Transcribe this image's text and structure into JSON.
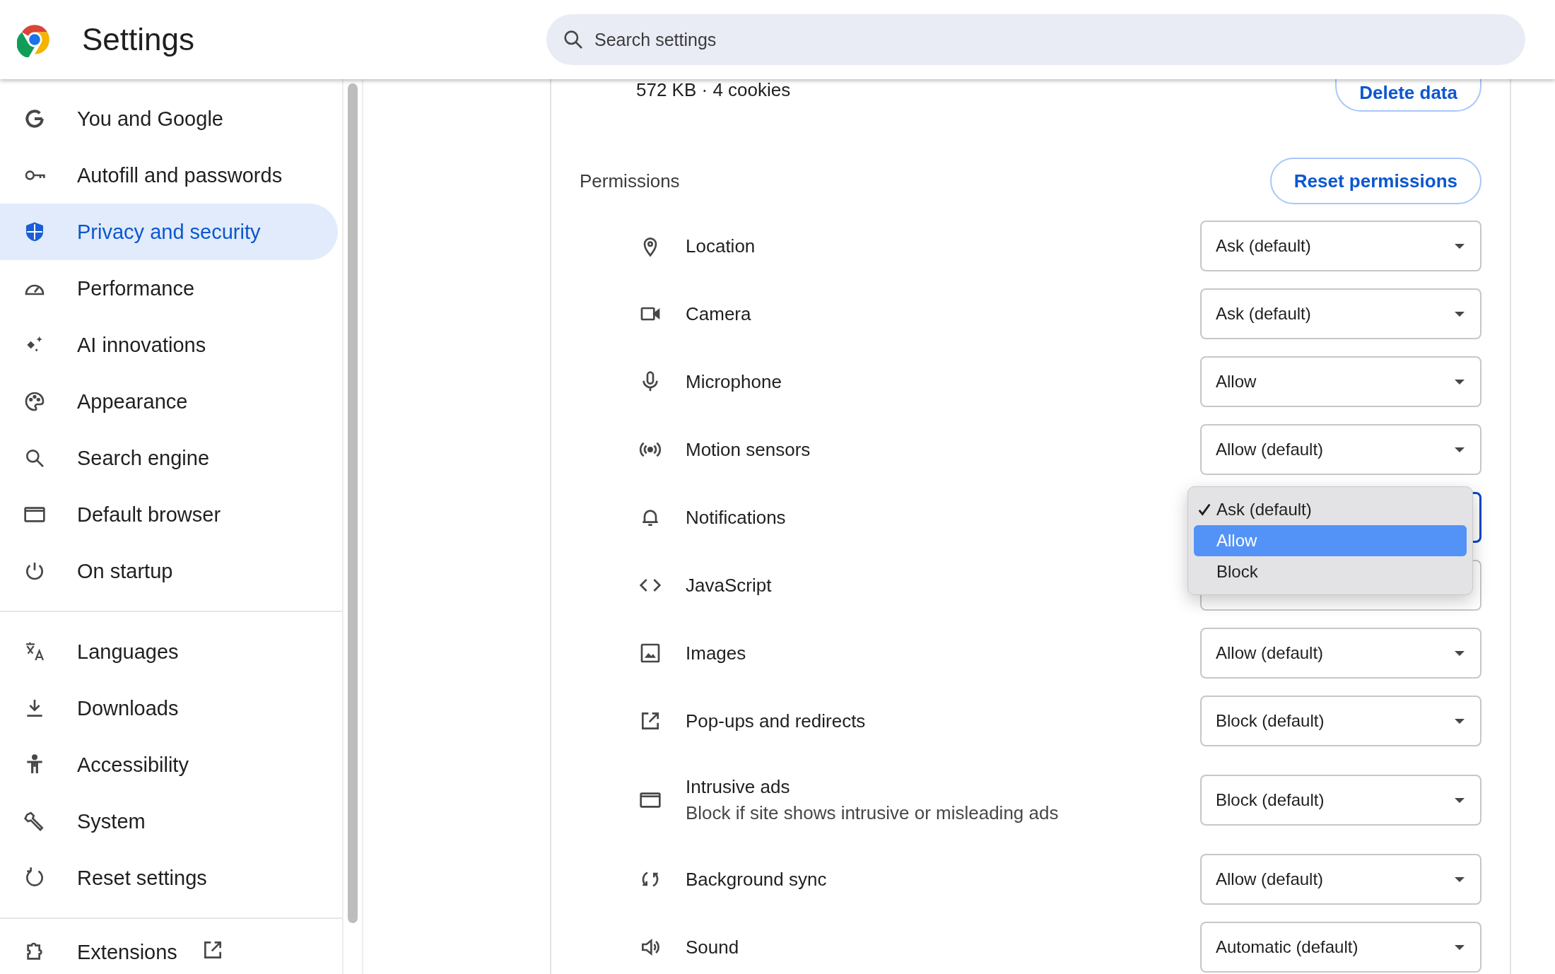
{
  "header": {
    "title": "Settings",
    "search": {
      "placeholder": "Search settings"
    }
  },
  "sidebar": {
    "groups": [
      [
        {
          "label": "You and Google",
          "selected": false
        },
        {
          "label": "Autofill and passwords",
          "selected": false
        },
        {
          "label": "Privacy and security",
          "selected": true
        },
        {
          "label": "Performance",
          "selected": false
        },
        {
          "label": "AI innovations",
          "selected": false
        },
        {
          "label": "Appearance",
          "selected": false
        },
        {
          "label": "Search engine",
          "selected": false
        },
        {
          "label": "Default browser",
          "selected": false
        },
        {
          "label": "On startup",
          "selected": false
        }
      ],
      [
        {
          "label": "Languages",
          "selected": false
        },
        {
          "label": "Downloads",
          "selected": false
        },
        {
          "label": "Accessibility",
          "selected": false
        },
        {
          "label": "System",
          "selected": false
        },
        {
          "label": "Reset settings",
          "selected": false
        }
      ]
    ],
    "extensions": {
      "label": "Extensions"
    }
  },
  "content": {
    "site_data": {
      "usage": "572 KB · 4 cookies",
      "delete_button": "Delete data"
    },
    "permissions": {
      "heading": "Permissions",
      "reset_button": "Reset permissions",
      "rows": [
        {
          "label": "Location",
          "value": "Ask (default)",
          "focused": false
        },
        {
          "label": "Camera",
          "value": "Ask (default)",
          "focused": false
        },
        {
          "label": "Microphone",
          "value": "Allow",
          "focused": false
        },
        {
          "label": "Motion sensors",
          "value": "Allow (default)",
          "focused": false
        },
        {
          "label": "Notifications",
          "focused": true
        },
        {
          "label": "JavaScript",
          "focused": false
        },
        {
          "label": "Images",
          "value": "Allow (default)",
          "focused": false
        },
        {
          "label": "Pop-ups and redirects",
          "value": "Block (default)",
          "focused": false
        },
        {
          "label": "Intrusive ads",
          "description": "Block if site shows intrusive or misleading ads",
          "value": "Block (default)",
          "focused": false
        },
        {
          "label": "Background sync",
          "value": "Allow (default)",
          "focused": false
        },
        {
          "label": "Sound",
          "value": "Automatic (default)",
          "focused": false
        }
      ]
    },
    "dropdown_menu": {
      "options": [
        {
          "label": "Ask (default)",
          "checked": true,
          "selected": false
        },
        {
          "label": "Allow",
          "checked": false,
          "selected": true
        },
        {
          "label": "Block",
          "checked": false,
          "selected": false
        }
      ]
    }
  }
}
